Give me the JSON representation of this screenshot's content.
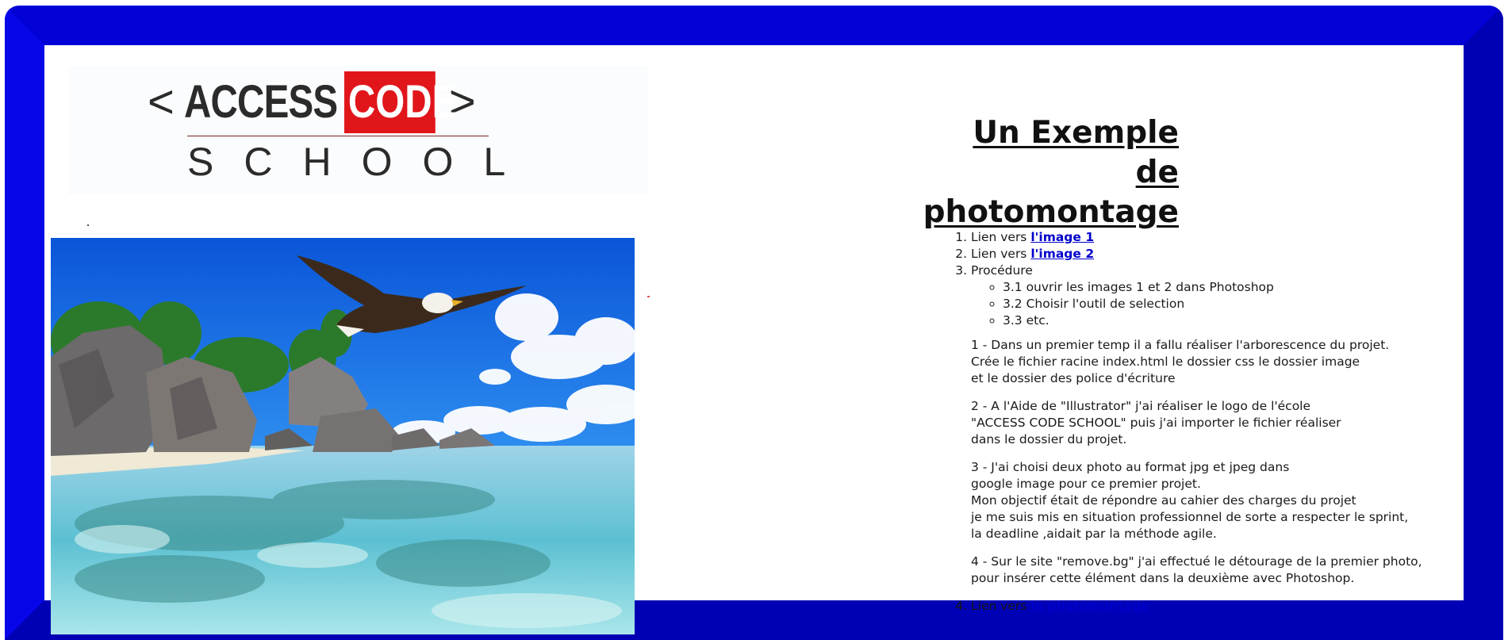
{
  "logo": {
    "bracket_left": "<",
    "word_access": "ACCESS",
    "word_code": "CODE",
    "bracket_right": ">",
    "word_school": "SCHOOL"
  },
  "title": {
    "line1": "Un Exemple",
    "line2": "de",
    "line3": "photomontage"
  },
  "list": {
    "item1_prefix": "Lien vers ",
    "item1_link": "l'image 1",
    "item2_prefix": "Lien vers ",
    "item2_link": "l'image 2",
    "item3_label": "Procédure",
    "sub_items": [
      "3.1 ouvrir les images 1 et 2 dans Photoshop",
      "3.2 Choisir l'outil de selection",
      "3.3 etc."
    ],
    "item4_prefix": "Lien vers ",
    "item4_link": "le photomontage"
  },
  "paragraphs": [
    [
      "1 - Dans un premier temp il a fallu réaliser l'arborescence du projet.",
      "Crée le fichier racine index.html le dossier css le dossier image",
      "et le dossier des police d'écriture"
    ],
    [
      "2 - A l'Aide de \"Illustrator\" j'ai réaliser le logo de l'école",
      "\"ACCESS CODE SCHOOL\" puis j'ai importer le fichier réaliser",
      "dans le dossier du projet."
    ],
    [
      "3 - J'ai choisi deux photo au format jpg et jpeg dans",
      "google image pour ce premier projet.",
      "Mon objectif était de répondre au cahier des charges du projet",
      "je me suis mis en situation professionnel de sorte a respecter le sprint,",
      "la deadline ,aidait par la méthode agile."
    ],
    [
      "4 - Sur le site \"remove.bg\" j'ai effectué le détourage de la premier photo,",
      "pour insérer cette élément dans la deuxième avec Photoshop."
    ]
  ],
  "colors": {
    "frame_blue": "#0000d0",
    "logo_red": "#e0161b",
    "link_blue": "#0000cc"
  }
}
